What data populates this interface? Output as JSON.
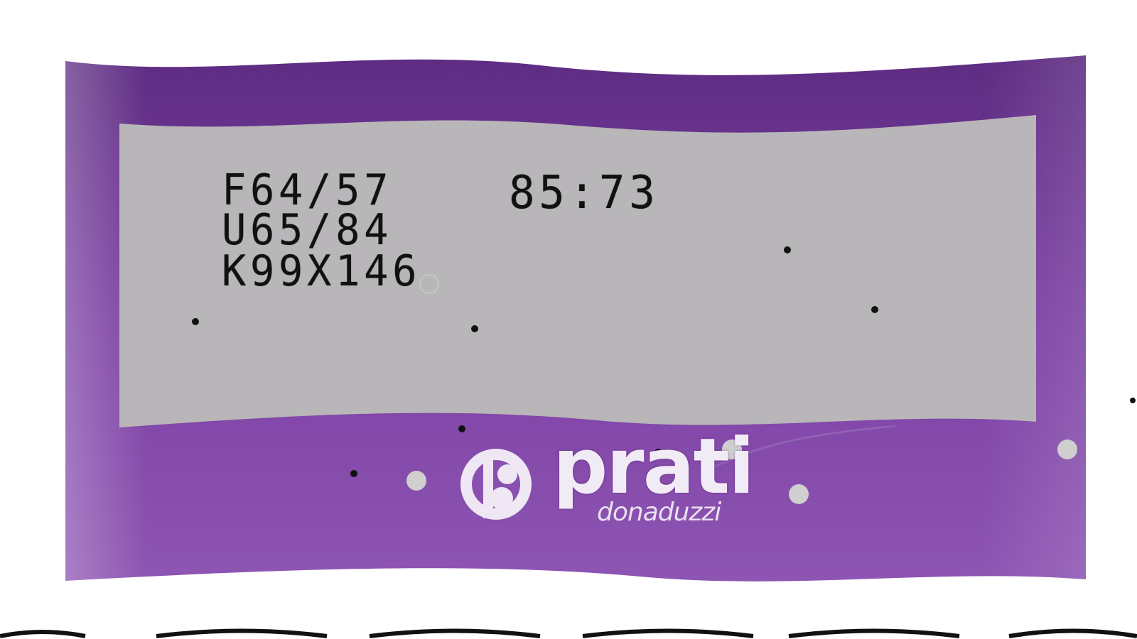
{
  "label": {
    "code_lines": [
      "F64/57",
      "U65/84",
      "K99X146"
    ],
    "time": "85:73"
  },
  "brand": {
    "name": "prati",
    "subname": "donaduzzi"
  },
  "colors": {
    "package_purple": "#7a3fa0",
    "label_gray": "#b7b5b8",
    "ink": "#111111"
  }
}
